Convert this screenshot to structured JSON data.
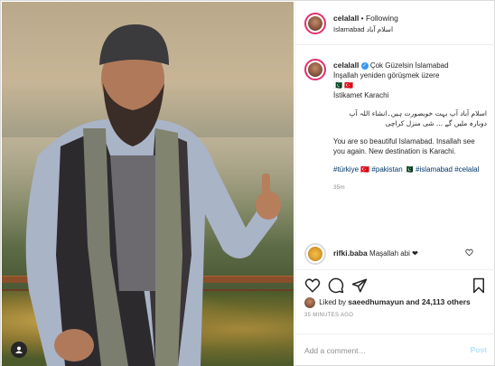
{
  "post": {
    "photo_alt": "",
    "author": {
      "username": "celalall",
      "follow_status": "Following",
      "location": "Islamabad اسلام آباد"
    },
    "caption": {
      "username": "celalall",
      "line1": "Çok Güzelsin İslamabad",
      "line2": "İnşallah yeniden görüşmek üzere",
      "line3": "🇵🇰 🇹🇷",
      "line4": "İstikamet Karachi",
      "urdu": "اسلام آباد آپ بہت خوبصورت ہیں۔انشاء اللہ آپ دوبارہ ملیں گے ... شی منزل کراچی",
      "english": "You are so beautiful Islamabad. Insallah see you again. New destination is Karachi.",
      "tags": "#türkiye 🇹🇷 #pakistan 🇵🇰 #islamabad #celalal",
      "time": "35m"
    },
    "comment": {
      "username": "rifki.baba",
      "text": "Maşallah abi ❤"
    },
    "likes": {
      "prefix": "Liked by",
      "user": "saeedhumayun",
      "suffix": "and 24,113 others"
    },
    "ago": "35 MINUTES AGO",
    "add_comment": {
      "placeholder": "Add a comment…",
      "post_label": "Post"
    }
  },
  "icons": {
    "like": "heart-icon",
    "comment": "speech-bubble-icon",
    "share": "paper-plane-icon",
    "save": "bookmark-icon",
    "more": "ellipsis-icon"
  },
  "colors": {
    "link": "#00376b",
    "verified": "#3897f0",
    "story_ring": "#e1306c",
    "post_disabled": "#b2dffc",
    "muted": "#8e8e8e"
  }
}
